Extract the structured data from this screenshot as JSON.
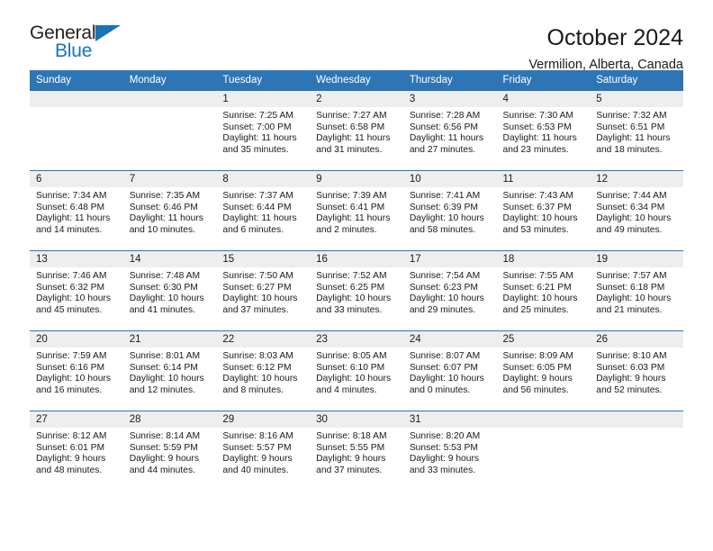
{
  "brand": {
    "name_part1": "General",
    "name_part2": "Blue",
    "accent_color": "#1b72b8",
    "logo_icon": "triangle-icon"
  },
  "header": {
    "title": "October 2024",
    "subtitle": "Vermilion, Alberta, Canada"
  },
  "theme": {
    "header_bar_color": "#2e75b6",
    "daynum_band_color": "#eeeeee",
    "row_divider_color": "#2e75b6"
  },
  "weekday_headers": [
    "Sunday",
    "Monday",
    "Tuesday",
    "Wednesday",
    "Thursday",
    "Friday",
    "Saturday"
  ],
  "labels": {
    "sunrise_prefix": "Sunrise: ",
    "sunset_prefix": "Sunset: ",
    "daylight_prefix": "Daylight: "
  },
  "weeks": [
    [
      {
        "day": "",
        "sunrise": "",
        "sunset": "",
        "daylight_line1": "",
        "daylight_line2": ""
      },
      {
        "day": "",
        "sunrise": "",
        "sunset": "",
        "daylight_line1": "",
        "daylight_line2": ""
      },
      {
        "day": "1",
        "sunrise": "Sunrise: 7:25 AM",
        "sunset": "Sunset: 7:00 PM",
        "daylight_line1": "Daylight: 11 hours",
        "daylight_line2": "and 35 minutes."
      },
      {
        "day": "2",
        "sunrise": "Sunrise: 7:27 AM",
        "sunset": "Sunset: 6:58 PM",
        "daylight_line1": "Daylight: 11 hours",
        "daylight_line2": "and 31 minutes."
      },
      {
        "day": "3",
        "sunrise": "Sunrise: 7:28 AM",
        "sunset": "Sunset: 6:56 PM",
        "daylight_line1": "Daylight: 11 hours",
        "daylight_line2": "and 27 minutes."
      },
      {
        "day": "4",
        "sunrise": "Sunrise: 7:30 AM",
        "sunset": "Sunset: 6:53 PM",
        "daylight_line1": "Daylight: 11 hours",
        "daylight_line2": "and 23 minutes."
      },
      {
        "day": "5",
        "sunrise": "Sunrise: 7:32 AM",
        "sunset": "Sunset: 6:51 PM",
        "daylight_line1": "Daylight: 11 hours",
        "daylight_line2": "and 18 minutes."
      }
    ],
    [
      {
        "day": "6",
        "sunrise": "Sunrise: 7:34 AM",
        "sunset": "Sunset: 6:48 PM",
        "daylight_line1": "Daylight: 11 hours",
        "daylight_line2": "and 14 minutes."
      },
      {
        "day": "7",
        "sunrise": "Sunrise: 7:35 AM",
        "sunset": "Sunset: 6:46 PM",
        "daylight_line1": "Daylight: 11 hours",
        "daylight_line2": "and 10 minutes."
      },
      {
        "day": "8",
        "sunrise": "Sunrise: 7:37 AM",
        "sunset": "Sunset: 6:44 PM",
        "daylight_line1": "Daylight: 11 hours",
        "daylight_line2": "and 6 minutes."
      },
      {
        "day": "9",
        "sunrise": "Sunrise: 7:39 AM",
        "sunset": "Sunset: 6:41 PM",
        "daylight_line1": "Daylight: 11 hours",
        "daylight_line2": "and 2 minutes."
      },
      {
        "day": "10",
        "sunrise": "Sunrise: 7:41 AM",
        "sunset": "Sunset: 6:39 PM",
        "daylight_line1": "Daylight: 10 hours",
        "daylight_line2": "and 58 minutes."
      },
      {
        "day": "11",
        "sunrise": "Sunrise: 7:43 AM",
        "sunset": "Sunset: 6:37 PM",
        "daylight_line1": "Daylight: 10 hours",
        "daylight_line2": "and 53 minutes."
      },
      {
        "day": "12",
        "sunrise": "Sunrise: 7:44 AM",
        "sunset": "Sunset: 6:34 PM",
        "daylight_line1": "Daylight: 10 hours",
        "daylight_line2": "and 49 minutes."
      }
    ],
    [
      {
        "day": "13",
        "sunrise": "Sunrise: 7:46 AM",
        "sunset": "Sunset: 6:32 PM",
        "daylight_line1": "Daylight: 10 hours",
        "daylight_line2": "and 45 minutes."
      },
      {
        "day": "14",
        "sunrise": "Sunrise: 7:48 AM",
        "sunset": "Sunset: 6:30 PM",
        "daylight_line1": "Daylight: 10 hours",
        "daylight_line2": "and 41 minutes."
      },
      {
        "day": "15",
        "sunrise": "Sunrise: 7:50 AM",
        "sunset": "Sunset: 6:27 PM",
        "daylight_line1": "Daylight: 10 hours",
        "daylight_line2": "and 37 minutes."
      },
      {
        "day": "16",
        "sunrise": "Sunrise: 7:52 AM",
        "sunset": "Sunset: 6:25 PM",
        "daylight_line1": "Daylight: 10 hours",
        "daylight_line2": "and 33 minutes."
      },
      {
        "day": "17",
        "sunrise": "Sunrise: 7:54 AM",
        "sunset": "Sunset: 6:23 PM",
        "daylight_line1": "Daylight: 10 hours",
        "daylight_line2": "and 29 minutes."
      },
      {
        "day": "18",
        "sunrise": "Sunrise: 7:55 AM",
        "sunset": "Sunset: 6:21 PM",
        "daylight_line1": "Daylight: 10 hours",
        "daylight_line2": "and 25 minutes."
      },
      {
        "day": "19",
        "sunrise": "Sunrise: 7:57 AM",
        "sunset": "Sunset: 6:18 PM",
        "daylight_line1": "Daylight: 10 hours",
        "daylight_line2": "and 21 minutes."
      }
    ],
    [
      {
        "day": "20",
        "sunrise": "Sunrise: 7:59 AM",
        "sunset": "Sunset: 6:16 PM",
        "daylight_line1": "Daylight: 10 hours",
        "daylight_line2": "and 16 minutes."
      },
      {
        "day": "21",
        "sunrise": "Sunrise: 8:01 AM",
        "sunset": "Sunset: 6:14 PM",
        "daylight_line1": "Daylight: 10 hours",
        "daylight_line2": "and 12 minutes."
      },
      {
        "day": "22",
        "sunrise": "Sunrise: 8:03 AM",
        "sunset": "Sunset: 6:12 PM",
        "daylight_line1": "Daylight: 10 hours",
        "daylight_line2": "and 8 minutes."
      },
      {
        "day": "23",
        "sunrise": "Sunrise: 8:05 AM",
        "sunset": "Sunset: 6:10 PM",
        "daylight_line1": "Daylight: 10 hours",
        "daylight_line2": "and 4 minutes."
      },
      {
        "day": "24",
        "sunrise": "Sunrise: 8:07 AM",
        "sunset": "Sunset: 6:07 PM",
        "daylight_line1": "Daylight: 10 hours",
        "daylight_line2": "and 0 minutes."
      },
      {
        "day": "25",
        "sunrise": "Sunrise: 8:09 AM",
        "sunset": "Sunset: 6:05 PM",
        "daylight_line1": "Daylight: 9 hours",
        "daylight_line2": "and 56 minutes."
      },
      {
        "day": "26",
        "sunrise": "Sunrise: 8:10 AM",
        "sunset": "Sunset: 6:03 PM",
        "daylight_line1": "Daylight: 9 hours",
        "daylight_line2": "and 52 minutes."
      }
    ],
    [
      {
        "day": "27",
        "sunrise": "Sunrise: 8:12 AM",
        "sunset": "Sunset: 6:01 PM",
        "daylight_line1": "Daylight: 9 hours",
        "daylight_line2": "and 48 minutes."
      },
      {
        "day": "28",
        "sunrise": "Sunrise: 8:14 AM",
        "sunset": "Sunset: 5:59 PM",
        "daylight_line1": "Daylight: 9 hours",
        "daylight_line2": "and 44 minutes."
      },
      {
        "day": "29",
        "sunrise": "Sunrise: 8:16 AM",
        "sunset": "Sunset: 5:57 PM",
        "daylight_line1": "Daylight: 9 hours",
        "daylight_line2": "and 40 minutes."
      },
      {
        "day": "30",
        "sunrise": "Sunrise: 8:18 AM",
        "sunset": "Sunset: 5:55 PM",
        "daylight_line1": "Daylight: 9 hours",
        "daylight_line2": "and 37 minutes."
      },
      {
        "day": "31",
        "sunrise": "Sunrise: 8:20 AM",
        "sunset": "Sunset: 5:53 PM",
        "daylight_line1": "Daylight: 9 hours",
        "daylight_line2": "and 33 minutes."
      },
      {
        "day": "",
        "sunrise": "",
        "sunset": "",
        "daylight_line1": "",
        "daylight_line2": ""
      },
      {
        "day": "",
        "sunrise": "",
        "sunset": "",
        "daylight_line1": "",
        "daylight_line2": ""
      }
    ]
  ]
}
